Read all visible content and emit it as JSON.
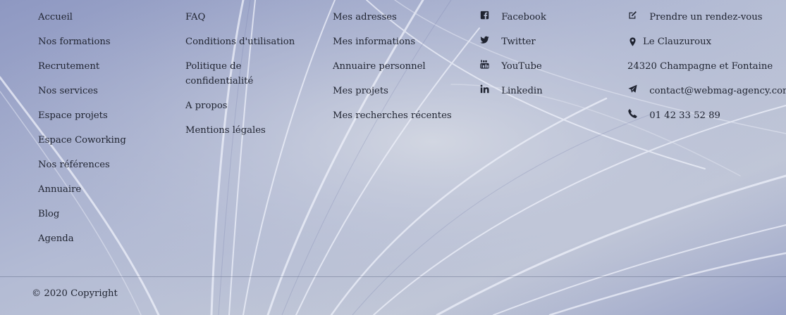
{
  "footer": {
    "col1": [
      "Accueil",
      "Nos formations",
      "Recrutement",
      "Nos services",
      "Espace projets",
      "Espace Coworking",
      "Nos références",
      "Annuaire",
      "Blog",
      "Agenda"
    ],
    "col2": [
      "FAQ",
      "Conditions d'utilisation",
      "Politique de confidentialité",
      "A propos",
      "Mentions légales"
    ],
    "col3": [
      "Mes adresses",
      "Mes informations",
      "Annuaire personnel",
      "Mes projets",
      "Mes recherches récentes"
    ],
    "social": [
      {
        "label": "Facebook",
        "icon": "facebook-icon"
      },
      {
        "label": "Twitter",
        "icon": "twitter-icon"
      },
      {
        "label": "YouTube",
        "icon": "youtube-icon"
      },
      {
        "label": "Linkedin",
        "icon": "linkedin-icon"
      }
    ],
    "contact": {
      "appointment": "Prendre un rendez-vous",
      "address_line1": "Le Clauzuroux",
      "address_line2": "24320 Champagne et Fontaine",
      "email": "contact@webmag-agency.com",
      "phone": "01 42 33 52 89"
    },
    "copyright": "© 2020 Copyright"
  },
  "colors": {
    "text": "#1f2330",
    "background": "#b7bfd6",
    "divider": "#5a6585"
  }
}
